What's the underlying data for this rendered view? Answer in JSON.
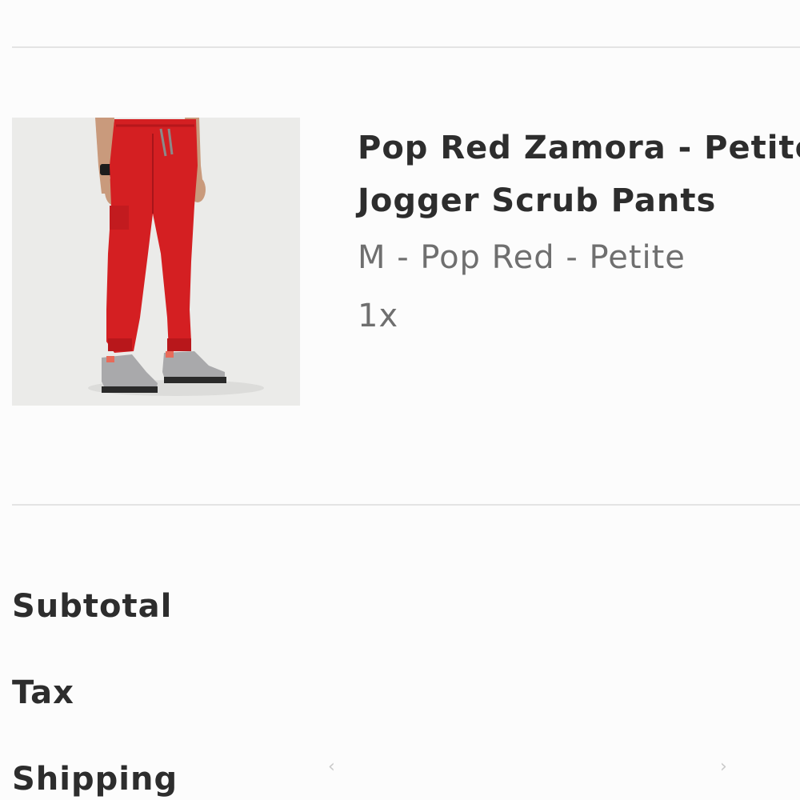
{
  "product": {
    "title_line1": "Pop Red Zamora - Petite",
    "title_line2": "Jogger Scrub Pants",
    "variant": "M - Pop Red - Petite",
    "quantity": "1x",
    "image_alt": "Red jogger scrub pants worn with grey sneakers"
  },
  "summary": {
    "subtotal_label": "Subtotal",
    "tax_label": "Tax",
    "shipping_label": "Shipping"
  },
  "carousel": {
    "prev_icon": "chevron-left-icon",
    "next_icon": "chevron-right-icon"
  },
  "colors": {
    "product_red": "#d41f22",
    "text_dark": "#2d2d2d",
    "text_muted": "#6f6f6f"
  }
}
